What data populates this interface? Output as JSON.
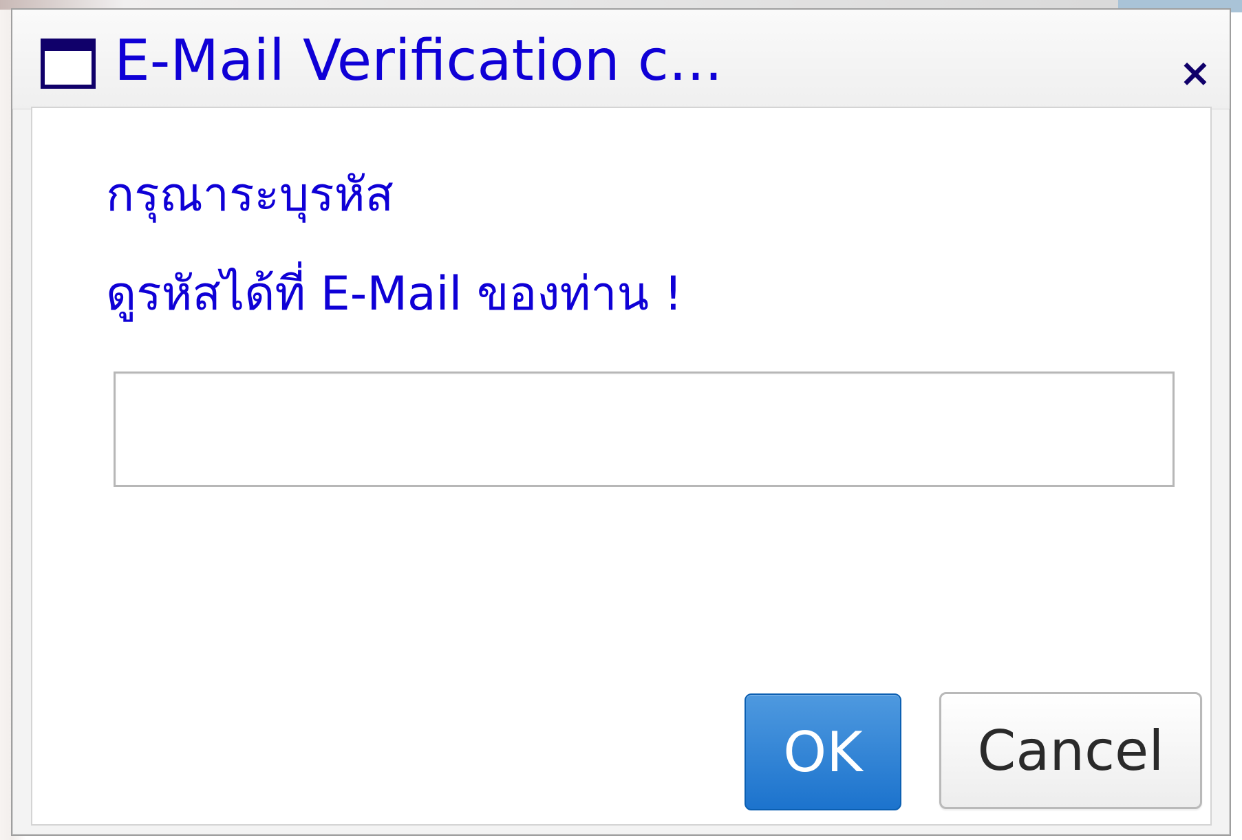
{
  "dialog": {
    "title": "E-Mail Verification c...",
    "window_icon": "window-icon",
    "close_icon": "close-icon",
    "close_label": "×",
    "prompt": {
      "line1": "กรุณาระบุรหัส",
      "line2": "ดูรหัสได้ที่ E-Mail ของท่าน !"
    },
    "verification_input": {
      "value": "",
      "placeholder": ""
    },
    "buttons": {
      "ok_label": "OK",
      "cancel_label": "Cancel"
    },
    "colors": {
      "title_text": "#0f00d6",
      "prompt_text": "#0f00d6",
      "primary_button": "#1c73cd",
      "secondary_button": "#ededed"
    }
  }
}
